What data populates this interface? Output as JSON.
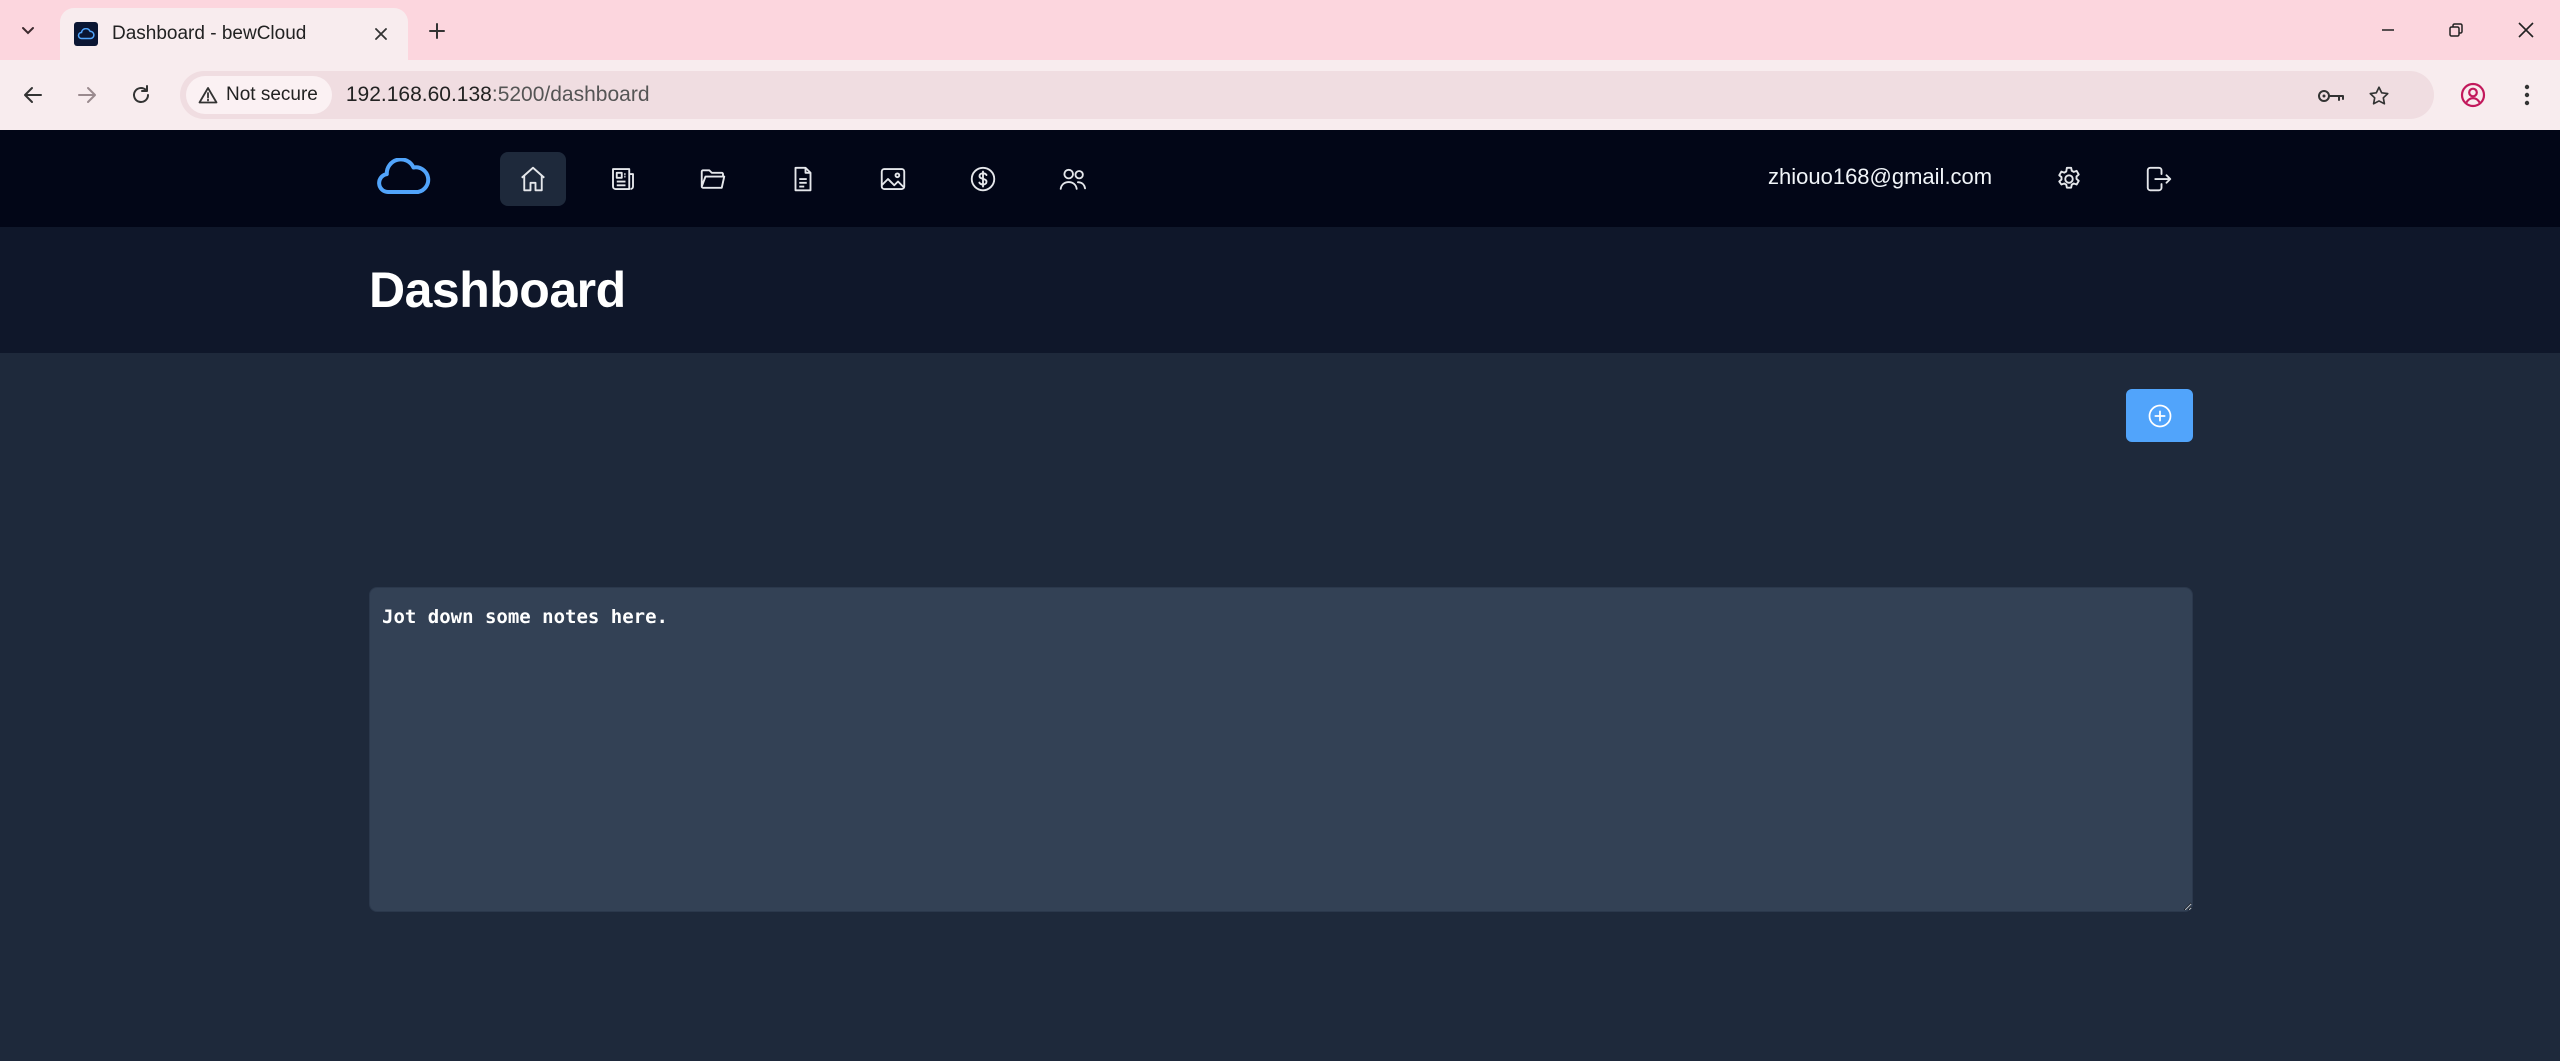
{
  "browser": {
    "tab_title": "Dashboard - bewCloud",
    "security_label": "Not secure",
    "url_host": "192.168.60.138",
    "url_rest": ":5200/dashboard"
  },
  "header": {
    "user_email": "zhiouo168@gmail.com",
    "nav_items": [
      {
        "icon": "home-icon",
        "active": true
      },
      {
        "icon": "news-icon",
        "active": false
      },
      {
        "icon": "folder-icon",
        "active": false
      },
      {
        "icon": "notes-icon",
        "active": false
      },
      {
        "icon": "photos-icon",
        "active": false
      },
      {
        "icon": "dollar-icon",
        "active": false
      },
      {
        "icon": "contacts-icon",
        "active": false
      }
    ]
  },
  "page": {
    "title": "Dashboard"
  },
  "notes": {
    "placeholder": "Jot down some notes here."
  },
  "colors": {
    "accent": "#51a4fb",
    "header_bg": "#020617",
    "title_bg": "#0f172a",
    "main_bg": "#1e293b",
    "textarea_bg": "#334155",
    "browser_tabstrip": "#fcd6de"
  }
}
